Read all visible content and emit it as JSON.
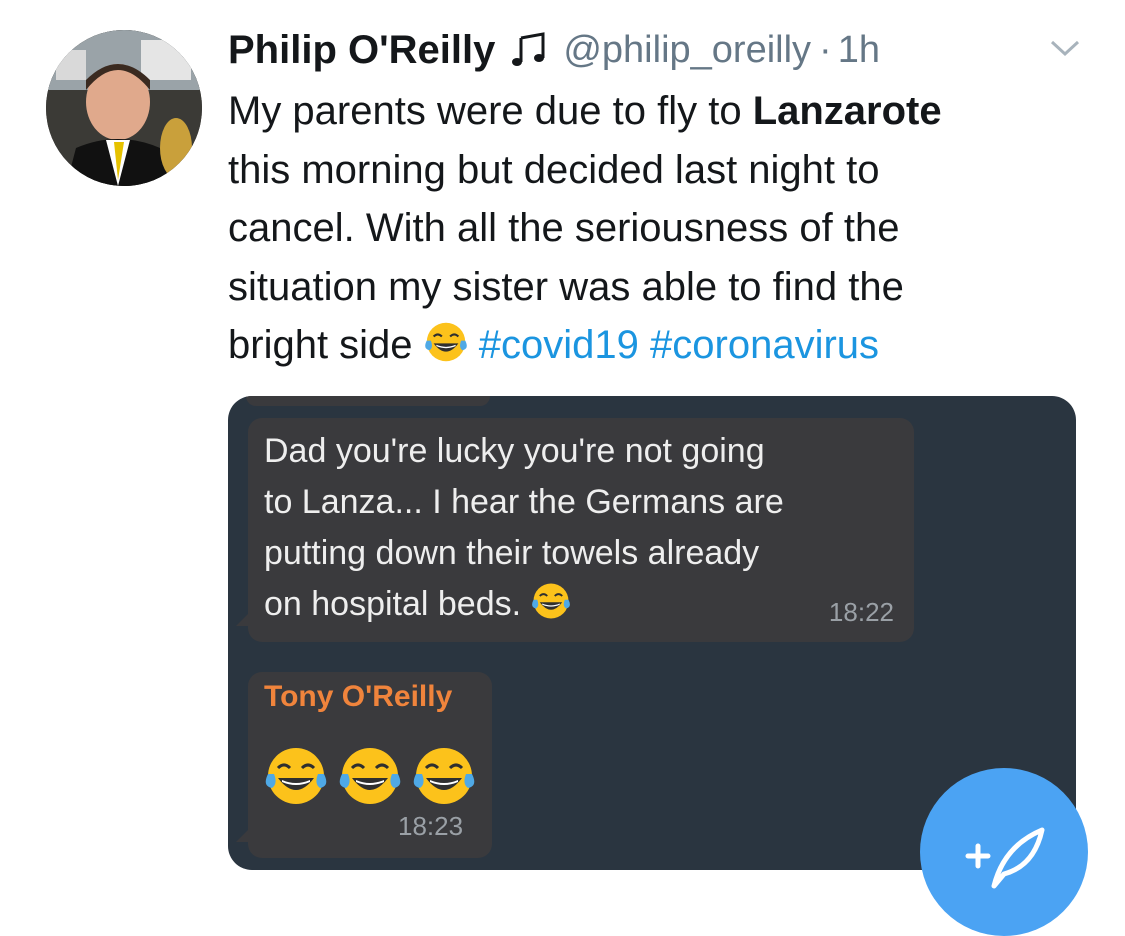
{
  "tweet": {
    "author_name": "Philip O'Reilly",
    "music_icon": "music-note-icon",
    "handle": "@philip_oreilly",
    "separator": "·",
    "time": "1h",
    "text_lines": [
      [
        "My parents were due to fly to ",
        "Lanzarote"
      ],
      [
        "this morning but decided last night to"
      ],
      [
        "cancel. With all the seriousness of the"
      ],
      [
        "situation my sister was able to find the"
      ]
    ],
    "last_line": {
      "text": "bright side ",
      "hashtag1": "#covid19",
      "hashtag2": "#coronavirus"
    }
  },
  "chat": {
    "message1": {
      "lines": [
        "Dad you're lucky you're not going",
        "to Lanza... I hear the Germans are",
        "putting down their towels already",
        "on hospital beds. "
      ],
      "time": "18:22"
    },
    "message2": {
      "sender": "Tony O'Reilly",
      "time": "18:23"
    }
  },
  "colors": {
    "hashtag": "#1b95e0",
    "chat_bg": "#2a3540",
    "bubble": "#3a3a3d",
    "sender": "#f0843c",
    "fab": "#4ba3f3"
  }
}
